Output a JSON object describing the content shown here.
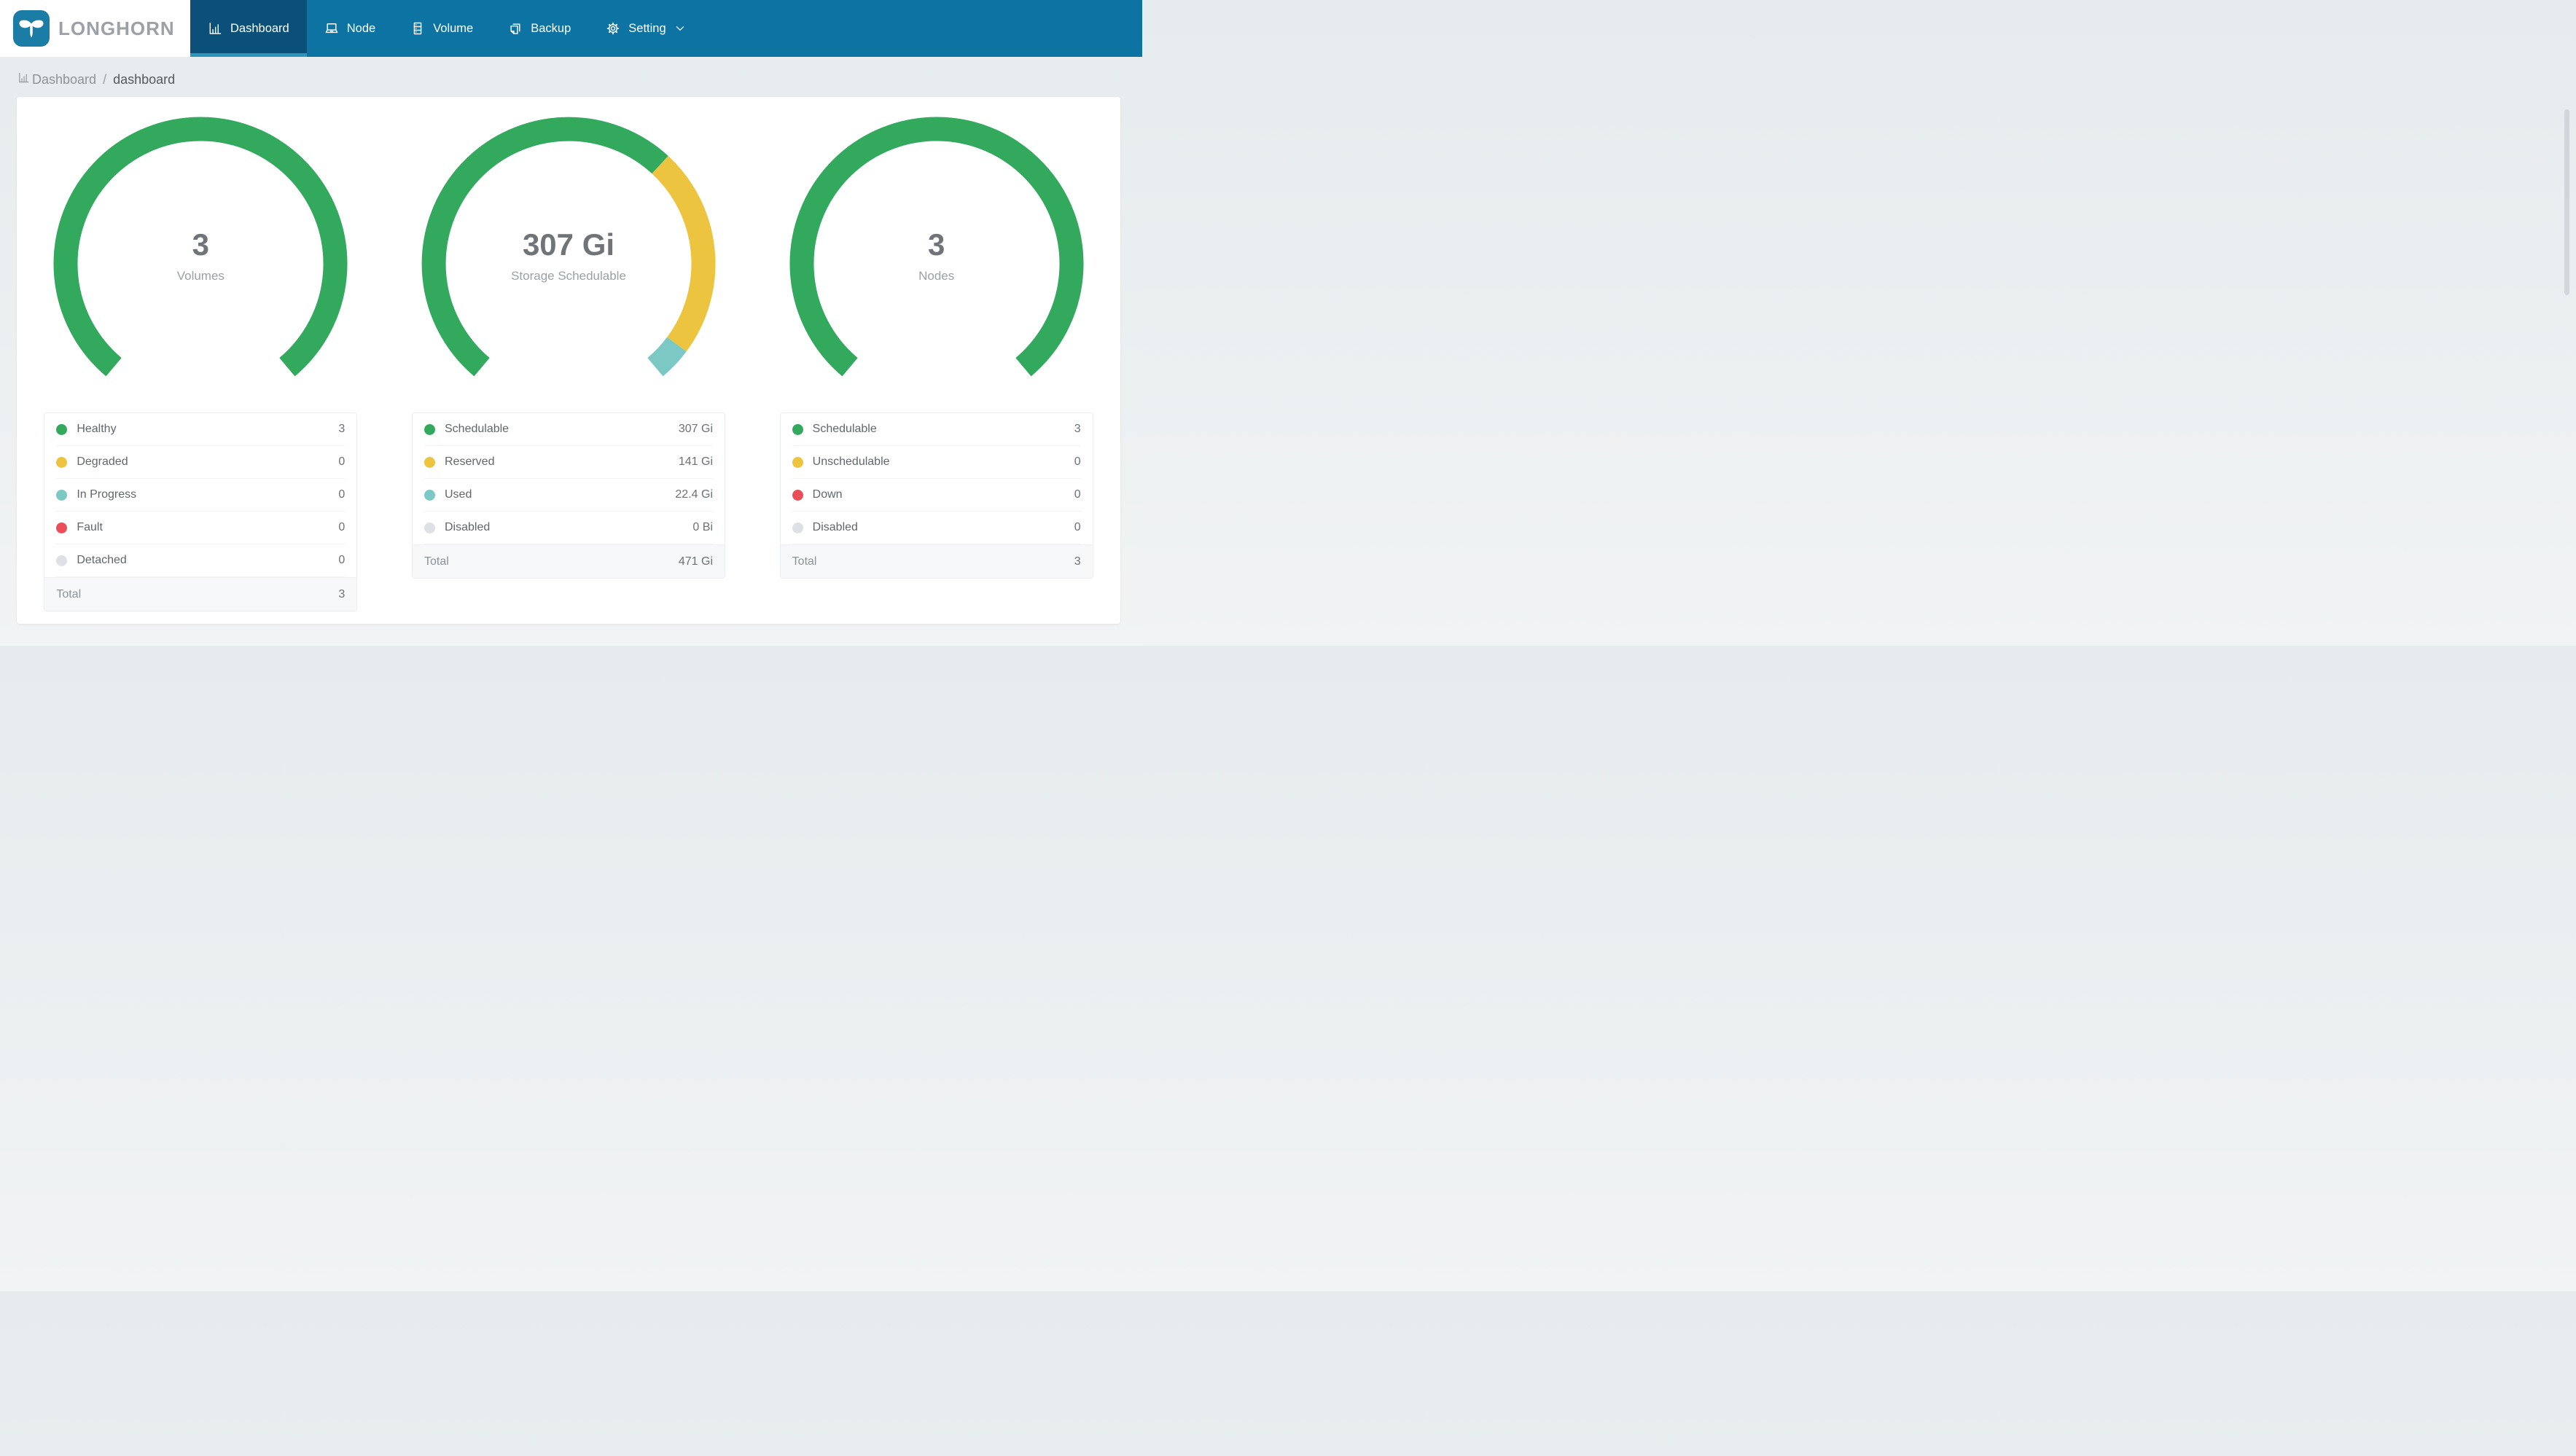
{
  "brand": {
    "name": "LONGHORN",
    "logo_color": "#1b7ca6",
    "text_color": "#9ba1a6"
  },
  "colors": {
    "navbar": "#0d73a2",
    "active_tab_bg": "#0a5078",
    "active_tab_underline": "#2d94ba",
    "green": "#33a95e",
    "yellow": "#ecc440",
    "teal": "#7bc8c5",
    "red": "#ea4f59",
    "gray": "#dde1e5"
  },
  "nav": {
    "items": [
      {
        "label": "Dashboard",
        "icon": "bar-chart-icon",
        "active": true
      },
      {
        "label": "Node",
        "icon": "laptop-icon",
        "active": false
      },
      {
        "label": "Volume",
        "icon": "server-icon",
        "active": false
      },
      {
        "label": "Backup",
        "icon": "copy-icon",
        "active": false
      },
      {
        "label": "Setting",
        "icon": "gear-icon",
        "active": false,
        "has_dropdown": true
      }
    ]
  },
  "breadcrumb": {
    "root": "Dashboard",
    "separator": "/",
    "current": "dashboard"
  },
  "chart_data": [
    {
      "type": "pie",
      "title": "Volumes",
      "center_value": "3",
      "categories": [
        "Healthy",
        "Degraded",
        "In Progress",
        "Fault",
        "Detached"
      ],
      "values": [
        3,
        0,
        0,
        0,
        0
      ]
    },
    {
      "type": "pie",
      "title": "Storage Schedulable",
      "center_value": "307 Gi",
      "categories": [
        "Schedulable",
        "Reserved",
        "Used",
        "Disabled"
      ],
      "values": [
        307,
        141,
        22.4,
        0
      ]
    },
    {
      "type": "pie",
      "title": "Nodes",
      "center_value": "3",
      "categories": [
        "Schedulable",
        "Unschedulable",
        "Down",
        "Disabled"
      ],
      "values": [
        3,
        0,
        0,
        0
      ]
    }
  ],
  "gauge_layout": {
    "start_deg": 220,
    "sweep_deg": 280
  },
  "cards": [
    {
      "center_value": "3",
      "center_caption": "Volumes",
      "table": {
        "rows": [
          {
            "label": "Healthy",
            "value": "3",
            "amount": 3,
            "color": "#33a95e"
          },
          {
            "label": "Degraded",
            "value": "0",
            "amount": 0,
            "color": "#ecc440"
          },
          {
            "label": "In Progress",
            "value": "0",
            "amount": 0,
            "color": "#7bc8c5"
          },
          {
            "label": "Fault",
            "value": "0",
            "amount": 0,
            "color": "#ea4f59"
          },
          {
            "label": "Detached",
            "value": "0",
            "amount": 0,
            "color": "#dde1e5"
          }
        ],
        "total_label": "Total",
        "total_value": "3"
      }
    },
    {
      "center_value": "307 Gi",
      "center_caption": "Storage Schedulable",
      "table": {
        "rows": [
          {
            "label": "Schedulable",
            "value": "307 Gi",
            "amount": 307,
            "color": "#33a95e"
          },
          {
            "label": "Reserved",
            "value": "141 Gi",
            "amount": 141,
            "color": "#ecc440"
          },
          {
            "label": "Used",
            "value": "22.4 Gi",
            "amount": 22.4,
            "color": "#7bc8c5"
          },
          {
            "label": "Disabled",
            "value": "0 Bi",
            "amount": 0,
            "color": "#dde1e5"
          }
        ],
        "total_label": "Total",
        "total_value": "471 Gi"
      }
    },
    {
      "center_value": "3",
      "center_caption": "Nodes",
      "table": {
        "rows": [
          {
            "label": "Schedulable",
            "value": "3",
            "amount": 3,
            "color": "#33a95e"
          },
          {
            "label": "Unschedulable",
            "value": "0",
            "amount": 0,
            "color": "#ecc440"
          },
          {
            "label": "Down",
            "value": "0",
            "amount": 0,
            "color": "#ea4f59"
          },
          {
            "label": "Disabled",
            "value": "0",
            "amount": 0,
            "color": "#dde1e5"
          }
        ],
        "total_label": "Total",
        "total_value": "3"
      }
    }
  ]
}
